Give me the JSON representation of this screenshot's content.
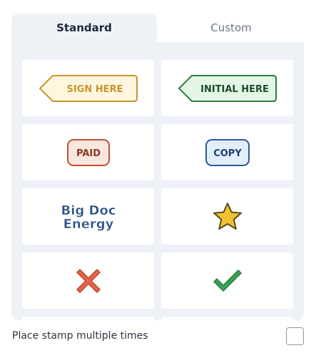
{
  "tabs": {
    "standard": "Standard",
    "custom": "Custom"
  },
  "stamps": {
    "sign_here": "SIGN HERE",
    "initial_here": "INITIAL HERE",
    "paid": "PAID",
    "copy": "COPY",
    "bde_line1": "Big Doc",
    "bde_line2": "Energy",
    "star_icon": "star-icon",
    "x_icon": "x-mark-icon",
    "check_icon": "checkmark-icon"
  },
  "footer": {
    "multi_label": "Place stamp multiple times",
    "multi_checked": false
  },
  "colors": {
    "sign_here": "#c8962a",
    "initial_here": "#2e7d3f",
    "paid": "#c0522e",
    "copy": "#2a5aa0",
    "bde": "#2b4e86",
    "star": "#f3c233",
    "x": "#e8644a",
    "check": "#3aa454"
  }
}
